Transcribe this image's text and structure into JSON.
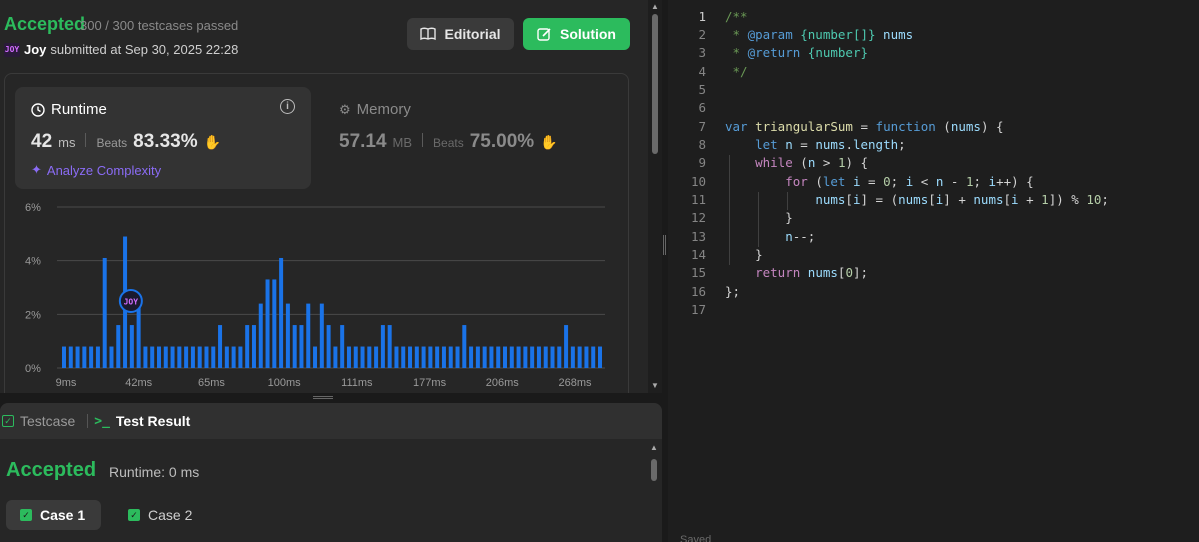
{
  "header": {
    "status": "Accepted",
    "testcases": "300 / 300 testcases passed",
    "avatar_text": "JOY",
    "user": "Joy",
    "submitted": "submitted at Sep 30, 2025 22:28",
    "editorial_label": "Editorial",
    "solution_label": "Solution"
  },
  "runtime": {
    "label": "Runtime",
    "value": "42",
    "unit": "ms",
    "beats_label": "Beats",
    "beats": "83.33%",
    "analyze_label": "Analyze Complexity"
  },
  "memory": {
    "label": "Memory",
    "value": "57.14",
    "unit": "MB",
    "beats_label": "Beats",
    "beats": "75.00%"
  },
  "colors": {
    "accent_green": "#2cbb5d",
    "bar_blue": "#1a73e8",
    "analyze_purple": "#8b6cf6"
  },
  "chart_data": {
    "type": "bar",
    "yticks": [
      "6%",
      "4%",
      "2%",
      "0%"
    ],
    "ylim": [
      0,
      6
    ],
    "xticks": [
      "9ms",
      "42ms",
      "65ms",
      "100ms",
      "111ms",
      "177ms",
      "206ms",
      "268ms"
    ],
    "marker_label": "JOY",
    "marker_bar_index": 10,
    "values": [
      0.8,
      0.8,
      0.8,
      0.8,
      0.8,
      0.8,
      4.1,
      0.8,
      1.6,
      4.9,
      1.6,
      2.4,
      0.8,
      0.8,
      0.8,
      0.8,
      0.8,
      0.8,
      0.8,
      0.8,
      0.8,
      0.8,
      0.8,
      1.6,
      0.8,
      0.8,
      0.8,
      1.6,
      1.6,
      2.4,
      3.3,
      3.3,
      4.1,
      2.4,
      1.6,
      1.6,
      2.4,
      0.8,
      2.4,
      1.6,
      0.8,
      1.6,
      0.8,
      0.8,
      0.8,
      0.8,
      0.8,
      1.6,
      1.6,
      0.8,
      0.8,
      0.8,
      0.8,
      0.8,
      0.8,
      0.8,
      0.8,
      0.8,
      0.8,
      1.6,
      0.8,
      0.8,
      0.8,
      0.8,
      0.8,
      0.8,
      0.8,
      0.8,
      0.8,
      0.8,
      0.8,
      0.8,
      0.8,
      0.8,
      1.6,
      0.8,
      0.8,
      0.8,
      0.8,
      0.8
    ]
  },
  "result": {
    "tab_testcase": "Testcase",
    "tab_testresult": "Test Result",
    "status": "Accepted",
    "runtime": "Runtime: 0 ms",
    "case1": "Case 1",
    "case2": "Case 2"
  },
  "editor": {
    "lines": [
      "1",
      "2",
      "3",
      "4",
      "5",
      "6",
      "7",
      "8",
      "9",
      "10",
      "11",
      "12",
      "13",
      "14",
      "15",
      "16",
      "17"
    ],
    "saved": "Saved"
  }
}
